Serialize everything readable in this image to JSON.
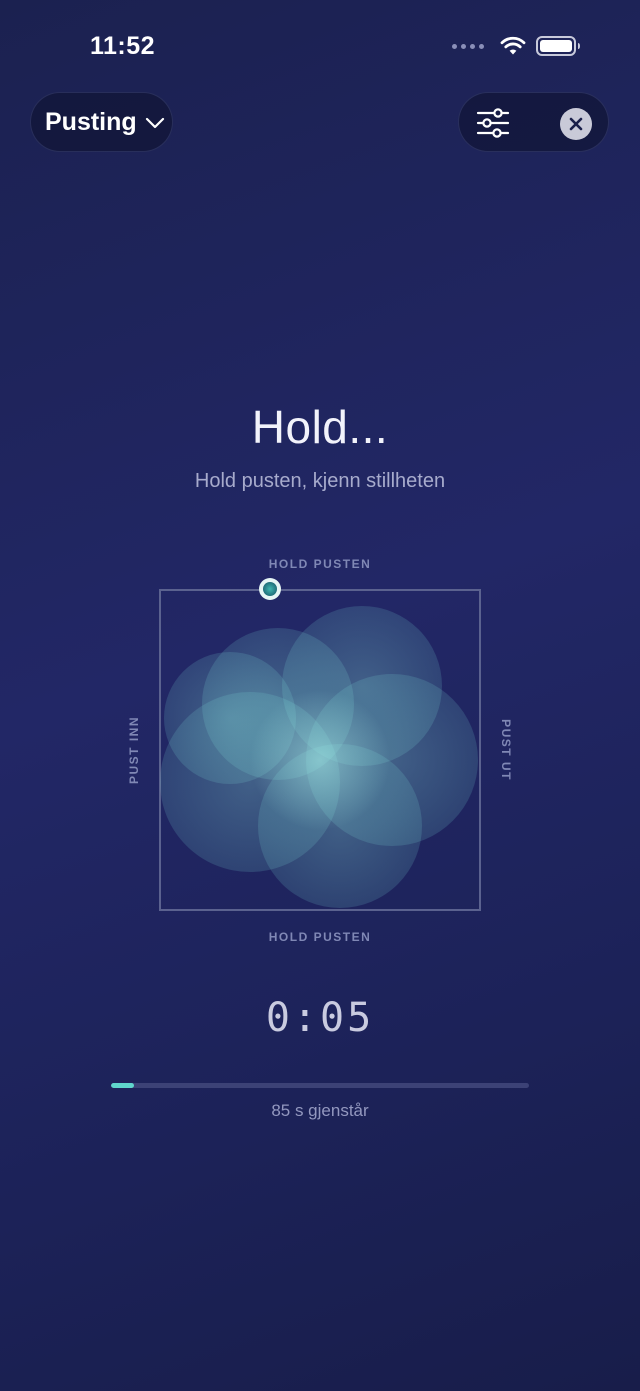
{
  "status_bar": {
    "time": "11:52"
  },
  "header": {
    "mode_label": "Pusting",
    "settings_icon": "sliders-icon",
    "close_icon": "close-icon"
  },
  "exercise": {
    "phase_title": "Hold...",
    "instruction": "Hold pusten, kjenn stillheten",
    "labels": {
      "top": "HOLD PUSTEN",
      "right": "PUST UT",
      "bottom": "HOLD PUSTEN",
      "left": "PUST INN"
    },
    "timer": "0:05",
    "remaining_text": "85 s gjenstår",
    "progress_fraction": 0.055
  },
  "colors": {
    "accent": "#5fd6cc",
    "background": "#222766",
    "petal": "#7fe3dc"
  }
}
